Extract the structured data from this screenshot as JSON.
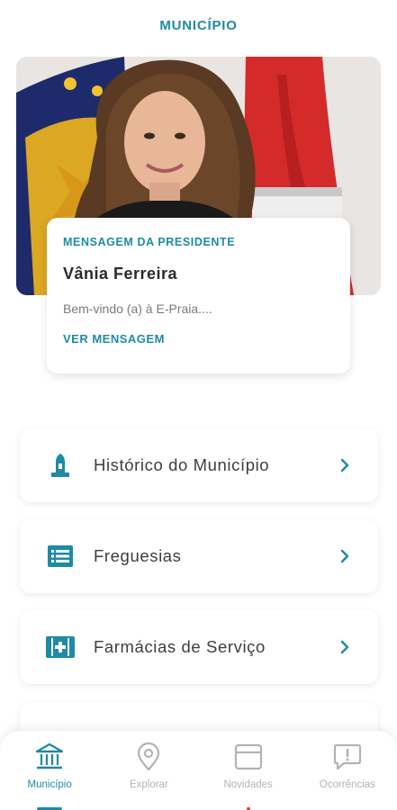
{
  "header": {
    "title": "MUNICÍPIO"
  },
  "message_card": {
    "kicker": "MENSAGEM DA PRESIDENTE",
    "name": "Vânia Ferreira",
    "text": "Bem-vindo (a) à E-Praia....",
    "link": "VER MENSAGEM"
  },
  "menu": {
    "items": [
      {
        "label": "Histórico do Município",
        "icon": "monument-icon"
      },
      {
        "label": "Freguesias",
        "icon": "list-icon"
      },
      {
        "label": "Farmácias de Serviço",
        "icon": "first-aid-icon"
      }
    ]
  },
  "bottom_nav": {
    "items": [
      {
        "label": "Município",
        "icon": "building-icon",
        "active": true
      },
      {
        "label": "Explorar",
        "icon": "map-pin-icon"
      },
      {
        "label": "Novidades",
        "icon": "news-icon"
      },
      {
        "label": "Ocorrências",
        "icon": "alert-chat-icon"
      }
    ]
  },
  "colors": {
    "accent": "#1e8aa3",
    "inactive": "#b3b3b3",
    "flag_red": "#d42a2a"
  }
}
